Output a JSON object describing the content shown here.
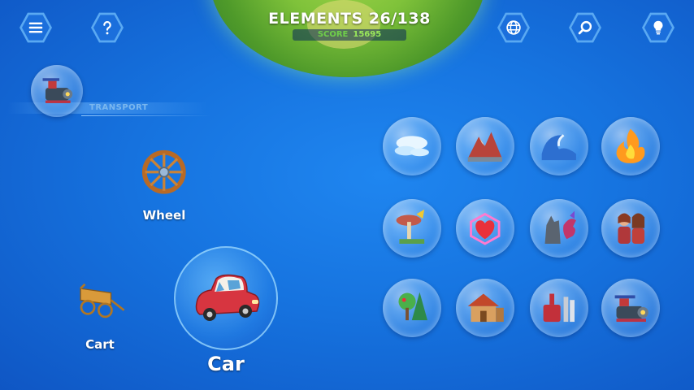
{
  "hud": {
    "elements_text": "ELEMENTS 26/138",
    "score_label": "SCORE",
    "score_value": "15695"
  },
  "buttons": [
    {
      "icon": "menu-icon"
    },
    {
      "icon": "help-icon"
    },
    {
      "icon": "globe-icon"
    },
    {
      "icon": "search-icon"
    },
    {
      "icon": "lightbulb-icon"
    }
  ],
  "category": {
    "label": "TRANSPORT",
    "icon": "locomotive-icon"
  },
  "workspace": {
    "wheel_label": "Wheel",
    "cart_label": "Cart",
    "car_label": "Car"
  },
  "library": [
    {
      "icon": "air-icon"
    },
    {
      "icon": "earth-icon"
    },
    {
      "icon": "water-icon"
    },
    {
      "icon": "fire-icon"
    },
    {
      "icon": "life-icon"
    },
    {
      "icon": "love-icon"
    },
    {
      "icon": "creatures-icon"
    },
    {
      "icon": "humans-icon"
    },
    {
      "icon": "plants-icon"
    },
    {
      "icon": "buildings-icon"
    },
    {
      "icon": "tools-icon"
    },
    {
      "icon": "transport-icon"
    }
  ]
}
